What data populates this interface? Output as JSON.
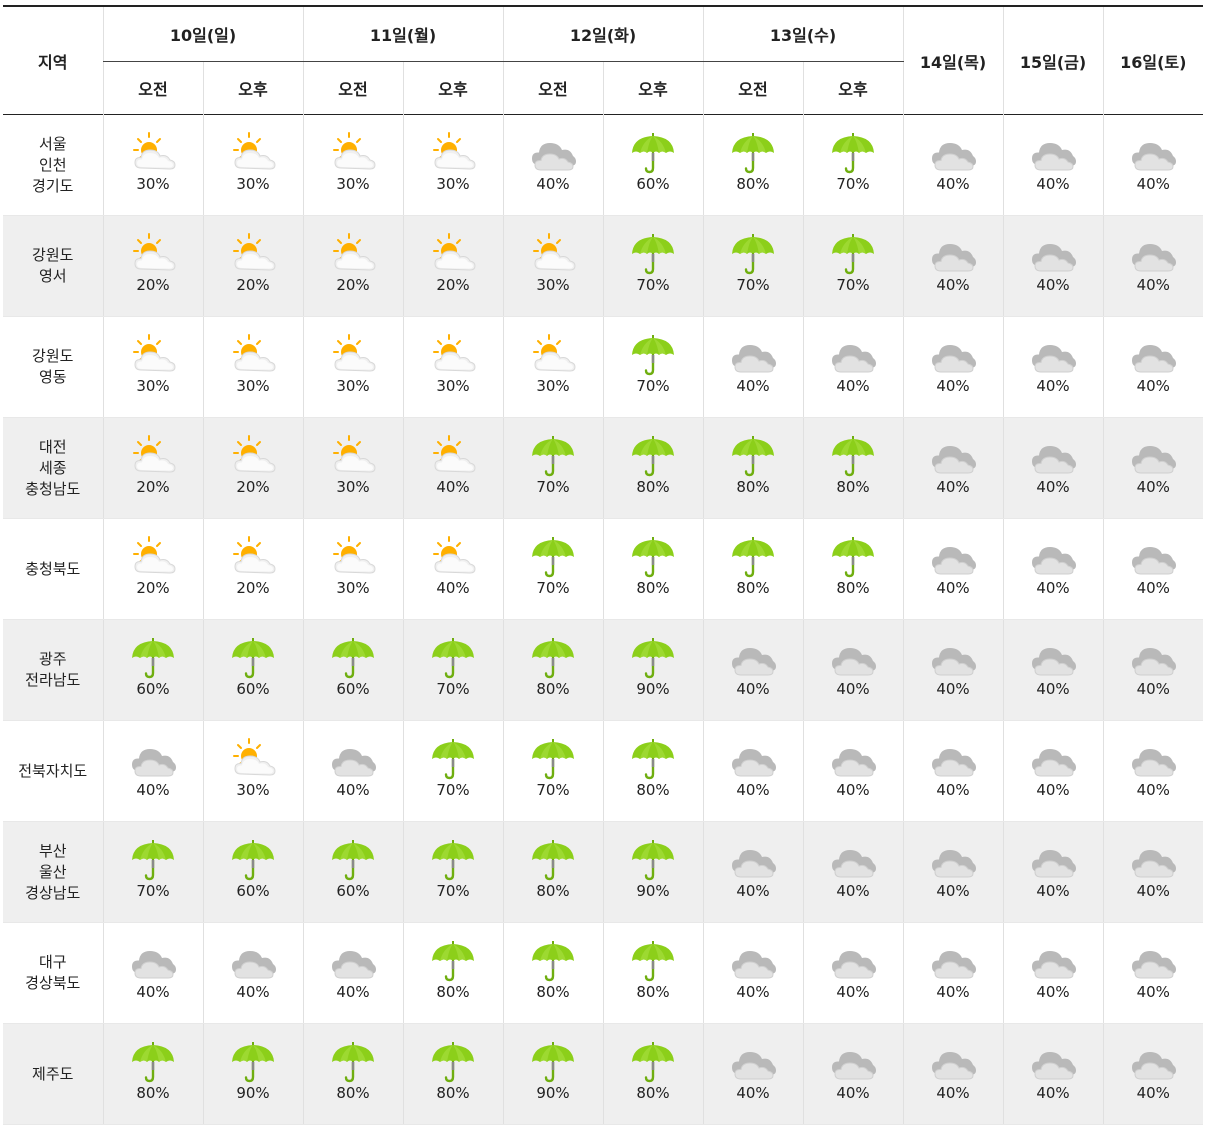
{
  "header": {
    "region_label": "지역",
    "days": [
      {
        "label": "10일(일)",
        "split": true
      },
      {
        "label": "11일(월)",
        "split": true
      },
      {
        "label": "12일(화)",
        "split": true
      },
      {
        "label": "13일(수)",
        "split": true
      },
      {
        "label": "14일(목)",
        "split": false
      },
      {
        "label": "15일(금)",
        "split": false
      },
      {
        "label": "16일(토)",
        "split": false
      }
    ],
    "am_label": "오전",
    "pm_label": "오후"
  },
  "icons": {
    "sun_cloud": {
      "name": "sun-cloud-icon",
      "sun_color": "#ffb000",
      "cloud_color": "#f0f0f0"
    },
    "cloud": {
      "name": "cloud-icon",
      "cloud_color": "#c9c9c9"
    },
    "rain": {
      "name": "umbrella-icon",
      "canopy_color": "#8ccf1a",
      "handle_color": "#6fae10"
    }
  },
  "rows": [
    {
      "region": [
        "서울",
        "인천",
        "경기도"
      ],
      "cells": [
        {
          "icon": "sun_cloud",
          "pct": "30%"
        },
        {
          "icon": "sun_cloud",
          "pct": "30%"
        },
        {
          "icon": "sun_cloud",
          "pct": "30%"
        },
        {
          "icon": "sun_cloud",
          "pct": "30%"
        },
        {
          "icon": "cloud",
          "pct": "40%"
        },
        {
          "icon": "rain",
          "pct": "60%"
        },
        {
          "icon": "rain",
          "pct": "80%"
        },
        {
          "icon": "rain",
          "pct": "70%"
        },
        {
          "icon": "cloud",
          "pct": "40%"
        },
        {
          "icon": "cloud",
          "pct": "40%"
        },
        {
          "icon": "cloud",
          "pct": "40%"
        }
      ]
    },
    {
      "region": [
        "강원도",
        "영서"
      ],
      "cells": [
        {
          "icon": "sun_cloud",
          "pct": "20%"
        },
        {
          "icon": "sun_cloud",
          "pct": "20%"
        },
        {
          "icon": "sun_cloud",
          "pct": "20%"
        },
        {
          "icon": "sun_cloud",
          "pct": "20%"
        },
        {
          "icon": "sun_cloud",
          "pct": "30%"
        },
        {
          "icon": "rain",
          "pct": "70%"
        },
        {
          "icon": "rain",
          "pct": "70%"
        },
        {
          "icon": "rain",
          "pct": "70%"
        },
        {
          "icon": "cloud",
          "pct": "40%"
        },
        {
          "icon": "cloud",
          "pct": "40%"
        },
        {
          "icon": "cloud",
          "pct": "40%"
        }
      ]
    },
    {
      "region": [
        "강원도",
        "영동"
      ],
      "cells": [
        {
          "icon": "sun_cloud",
          "pct": "30%"
        },
        {
          "icon": "sun_cloud",
          "pct": "30%"
        },
        {
          "icon": "sun_cloud",
          "pct": "30%"
        },
        {
          "icon": "sun_cloud",
          "pct": "30%"
        },
        {
          "icon": "sun_cloud",
          "pct": "30%"
        },
        {
          "icon": "rain",
          "pct": "70%"
        },
        {
          "icon": "cloud",
          "pct": "40%"
        },
        {
          "icon": "cloud",
          "pct": "40%"
        },
        {
          "icon": "cloud",
          "pct": "40%"
        },
        {
          "icon": "cloud",
          "pct": "40%"
        },
        {
          "icon": "cloud",
          "pct": "40%"
        }
      ]
    },
    {
      "region": [
        "대전",
        "세종",
        "충청남도"
      ],
      "cells": [
        {
          "icon": "sun_cloud",
          "pct": "20%"
        },
        {
          "icon": "sun_cloud",
          "pct": "20%"
        },
        {
          "icon": "sun_cloud",
          "pct": "30%"
        },
        {
          "icon": "sun_cloud",
          "pct": "40%"
        },
        {
          "icon": "rain",
          "pct": "70%"
        },
        {
          "icon": "rain",
          "pct": "80%"
        },
        {
          "icon": "rain",
          "pct": "80%"
        },
        {
          "icon": "rain",
          "pct": "80%"
        },
        {
          "icon": "cloud",
          "pct": "40%"
        },
        {
          "icon": "cloud",
          "pct": "40%"
        },
        {
          "icon": "cloud",
          "pct": "40%"
        }
      ]
    },
    {
      "region": [
        "충청북도"
      ],
      "cells": [
        {
          "icon": "sun_cloud",
          "pct": "20%"
        },
        {
          "icon": "sun_cloud",
          "pct": "20%"
        },
        {
          "icon": "sun_cloud",
          "pct": "30%"
        },
        {
          "icon": "sun_cloud",
          "pct": "40%"
        },
        {
          "icon": "rain",
          "pct": "70%"
        },
        {
          "icon": "rain",
          "pct": "80%"
        },
        {
          "icon": "rain",
          "pct": "80%"
        },
        {
          "icon": "rain",
          "pct": "80%"
        },
        {
          "icon": "cloud",
          "pct": "40%"
        },
        {
          "icon": "cloud",
          "pct": "40%"
        },
        {
          "icon": "cloud",
          "pct": "40%"
        }
      ]
    },
    {
      "region": [
        "광주",
        "전라남도"
      ],
      "cells": [
        {
          "icon": "rain",
          "pct": "60%"
        },
        {
          "icon": "rain",
          "pct": "60%"
        },
        {
          "icon": "rain",
          "pct": "60%"
        },
        {
          "icon": "rain",
          "pct": "70%"
        },
        {
          "icon": "rain",
          "pct": "80%"
        },
        {
          "icon": "rain",
          "pct": "90%"
        },
        {
          "icon": "cloud",
          "pct": "40%"
        },
        {
          "icon": "cloud",
          "pct": "40%"
        },
        {
          "icon": "cloud",
          "pct": "40%"
        },
        {
          "icon": "cloud",
          "pct": "40%"
        },
        {
          "icon": "cloud",
          "pct": "40%"
        }
      ]
    },
    {
      "region": [
        "전북자치도"
      ],
      "cells": [
        {
          "icon": "cloud",
          "pct": "40%"
        },
        {
          "icon": "sun_cloud",
          "pct": "30%"
        },
        {
          "icon": "cloud",
          "pct": "40%"
        },
        {
          "icon": "rain",
          "pct": "70%"
        },
        {
          "icon": "rain",
          "pct": "70%"
        },
        {
          "icon": "rain",
          "pct": "80%"
        },
        {
          "icon": "cloud",
          "pct": "40%"
        },
        {
          "icon": "cloud",
          "pct": "40%"
        },
        {
          "icon": "cloud",
          "pct": "40%"
        },
        {
          "icon": "cloud",
          "pct": "40%"
        },
        {
          "icon": "cloud",
          "pct": "40%"
        }
      ]
    },
    {
      "region": [
        "부산",
        "울산",
        "경상남도"
      ],
      "cells": [
        {
          "icon": "rain",
          "pct": "70%"
        },
        {
          "icon": "rain",
          "pct": "60%"
        },
        {
          "icon": "rain",
          "pct": "60%"
        },
        {
          "icon": "rain",
          "pct": "70%"
        },
        {
          "icon": "rain",
          "pct": "80%"
        },
        {
          "icon": "rain",
          "pct": "90%"
        },
        {
          "icon": "cloud",
          "pct": "40%"
        },
        {
          "icon": "cloud",
          "pct": "40%"
        },
        {
          "icon": "cloud",
          "pct": "40%"
        },
        {
          "icon": "cloud",
          "pct": "40%"
        },
        {
          "icon": "cloud",
          "pct": "40%"
        }
      ]
    },
    {
      "region": [
        "대구",
        "경상북도"
      ],
      "cells": [
        {
          "icon": "cloud",
          "pct": "40%"
        },
        {
          "icon": "cloud",
          "pct": "40%"
        },
        {
          "icon": "cloud",
          "pct": "40%"
        },
        {
          "icon": "rain",
          "pct": "80%"
        },
        {
          "icon": "rain",
          "pct": "80%"
        },
        {
          "icon": "rain",
          "pct": "80%"
        },
        {
          "icon": "cloud",
          "pct": "40%"
        },
        {
          "icon": "cloud",
          "pct": "40%"
        },
        {
          "icon": "cloud",
          "pct": "40%"
        },
        {
          "icon": "cloud",
          "pct": "40%"
        },
        {
          "icon": "cloud",
          "pct": "40%"
        }
      ]
    },
    {
      "region": [
        "제주도"
      ],
      "cells": [
        {
          "icon": "rain",
          "pct": "80%"
        },
        {
          "icon": "rain",
          "pct": "90%"
        },
        {
          "icon": "rain",
          "pct": "80%"
        },
        {
          "icon": "rain",
          "pct": "80%"
        },
        {
          "icon": "rain",
          "pct": "90%"
        },
        {
          "icon": "rain",
          "pct": "80%"
        },
        {
          "icon": "cloud",
          "pct": "40%"
        },
        {
          "icon": "cloud",
          "pct": "40%"
        },
        {
          "icon": "cloud",
          "pct": "40%"
        },
        {
          "icon": "cloud",
          "pct": "40%"
        },
        {
          "icon": "cloud",
          "pct": "40%"
        }
      ]
    }
  ]
}
